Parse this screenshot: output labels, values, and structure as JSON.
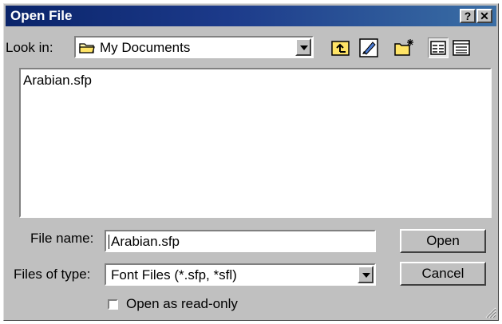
{
  "window": {
    "title": "Open File",
    "help_label": "?",
    "close_label": "✕"
  },
  "look_in": {
    "label": "Look in:",
    "value": "My Documents"
  },
  "toolbar": [
    "up-one-level",
    "explore-desktop",
    "create-new-folder",
    "list-view",
    "details-view"
  ],
  "files": [
    "Arabian.sfp"
  ],
  "file_name": {
    "label": "File name:",
    "value": "Arabian.sfp"
  },
  "file_type": {
    "label": "Files of type:",
    "value": "Font Files (*.sfp, *sfl)"
  },
  "buttons": {
    "open": "Open",
    "cancel": "Cancel"
  },
  "readonly": {
    "label": "Open as read-only",
    "checked": false
  },
  "colors": {
    "title_bar": "#0a246a",
    "face": "#c0c0c0"
  }
}
